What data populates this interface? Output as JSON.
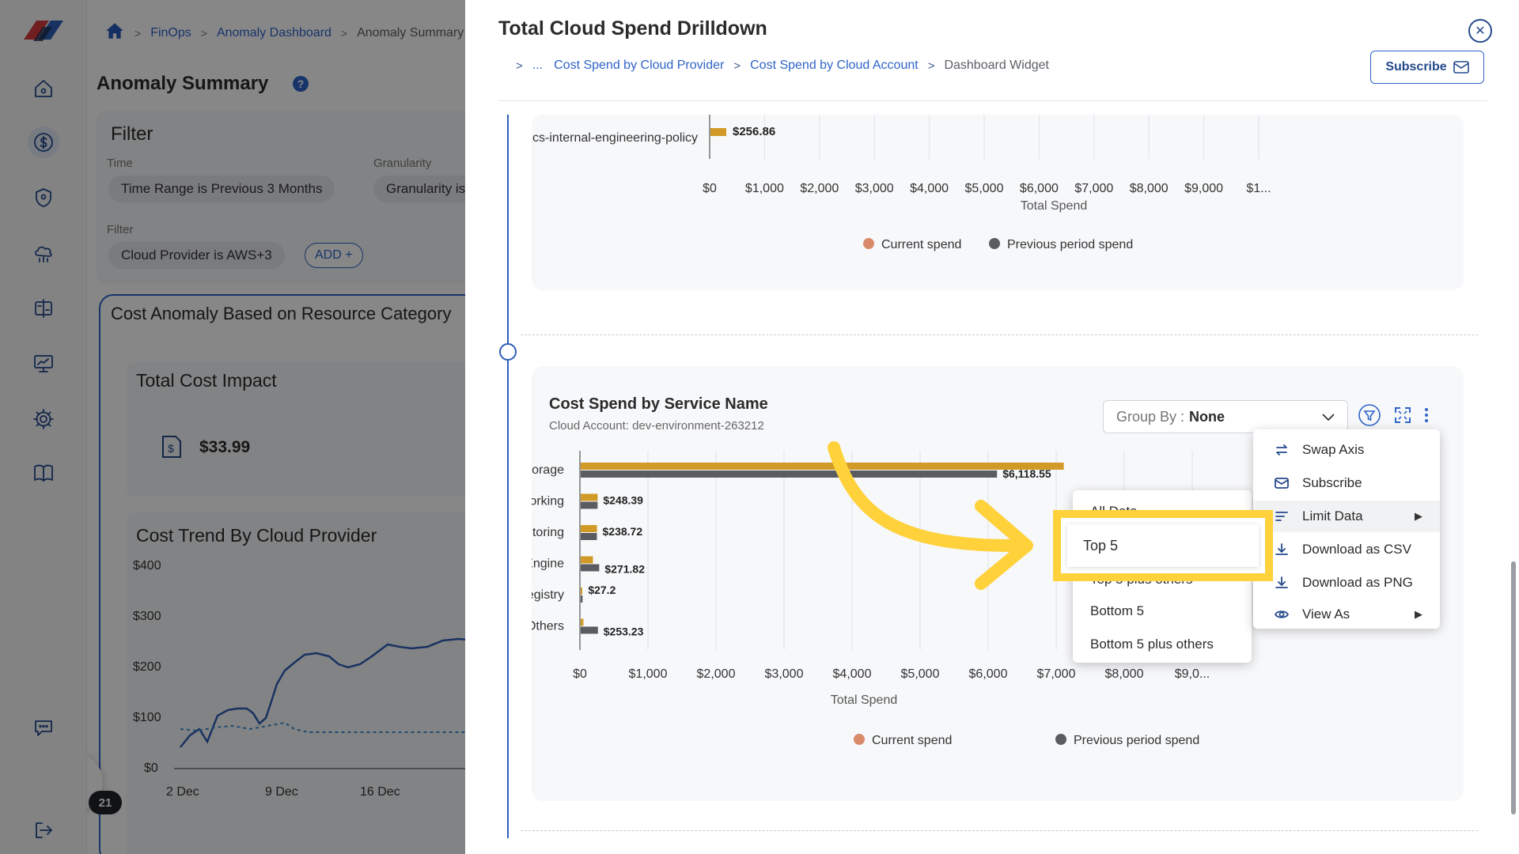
{
  "background_page": {
    "breadcrumb": [
      "FinOps",
      "Anomaly Dashboard",
      "Anomaly Summary"
    ],
    "title": "Anomaly Summary",
    "filter": {
      "title": "Filter",
      "time_label": "Time",
      "time_chip": "Time Range is Previous 3 Months",
      "granularity_label": "Granularity",
      "granularity_chip": "Granularity is",
      "filter_label": "Filter",
      "provider_chip": "Cloud Provider is AWS+3",
      "add_label": "ADD +"
    },
    "anomaly_card_title": "Cost Anomaly Based on Resource Category",
    "total_cost_impact": {
      "title": "Total Cost Impact",
      "value": "$33.99"
    },
    "cost_trend": {
      "title": "Cost Trend By Cloud Provider",
      "y_ticks": [
        "$400",
        "$300",
        "$200",
        "$100",
        "$0"
      ],
      "x_ticks": [
        "2 Dec",
        "9 Dec",
        "16 Dec"
      ]
    },
    "chat_badge": "21"
  },
  "drawer": {
    "title": "Total Cloud Spend Drilldown",
    "breadcrumb": [
      "...",
      "Cost Spend by Cloud Provider",
      "Cost Spend by Cloud Account",
      "Dashboard Widget"
    ],
    "subscribe_label": "Subscribe",
    "upper_chart": {
      "row_label": "cs-internal-engineering-policy",
      "value_label": "$256.86",
      "x_ticks": [
        "$0",
        "$1,000",
        "$2,000",
        "$3,000",
        "$4,000",
        "$5,000",
        "$6,000",
        "$7,000",
        "$8,000",
        "$9,000",
        "$1..."
      ],
      "x_axis_label": "Total Spend",
      "legend": [
        "Current spend",
        "Previous period spend"
      ]
    },
    "widget": {
      "title": "Cost Spend by Service Name",
      "subtitle": "Cloud Account: dev-environment-263212",
      "group_by_label": "Group By :",
      "group_by_value": "None"
    },
    "colors": {
      "current": "#d19a26",
      "previous": "#5a5c61",
      "accent": "#2f64c8",
      "highlight": "#ffd13a"
    }
  },
  "chart_data": {
    "type": "bar",
    "orientation": "horizontal",
    "title": "Cost Spend by Service Name",
    "subtitle": "Cloud Account: dev-environment-263212",
    "xlabel": "Total Spend",
    "ylabel": "",
    "xlim": [
      0,
      9000
    ],
    "x_ticks": [
      "$0",
      "$1,000",
      "$2,000",
      "$3,000",
      "$4,000",
      "$5,000",
      "$6,000",
      "$7,000",
      "$8,000",
      "$9,0..."
    ],
    "categories": [
      "Cloud Storage",
      "Networking",
      "Cloud Monitoring",
      "Compute Engine",
      "Artifact Registry",
      "Others"
    ],
    "series": [
      {
        "name": "Current spend",
        "values": [
          7100,
          248.39,
          238.72,
          180,
          15,
          40
        ]
      },
      {
        "name": "Previous period spend",
        "values": [
          6118.55,
          248,
          238,
          271.82,
          27.2,
          253.23
        ]
      }
    ],
    "data_labels": [
      "$6,118.55",
      "$248.39",
      "$238.72",
      "$271.82",
      "$27.2",
      "$253.23"
    ],
    "legend": [
      "Current spend",
      "Previous period spend"
    ],
    "legend_position": "bottom",
    "grid": true
  },
  "context_menu": {
    "items": [
      {
        "label": "Swap Axis",
        "icon": "swap-axis-icon"
      },
      {
        "label": "Subscribe",
        "icon": "subscribe-icon"
      },
      {
        "label": "Limit Data",
        "icon": "limit-data-icon",
        "submenu": true
      },
      {
        "label": "Download as CSV",
        "icon": "download-icon"
      },
      {
        "label": "Download as PNG",
        "icon": "download-icon"
      },
      {
        "label": "View As",
        "icon": "view-icon",
        "submenu": true
      }
    ]
  },
  "limit_submenu": {
    "items": [
      "All Data",
      "Top 5",
      "Top 5 plus others",
      "Bottom 5",
      "Bottom 5 plus others"
    ],
    "highlighted": "Top 5"
  }
}
